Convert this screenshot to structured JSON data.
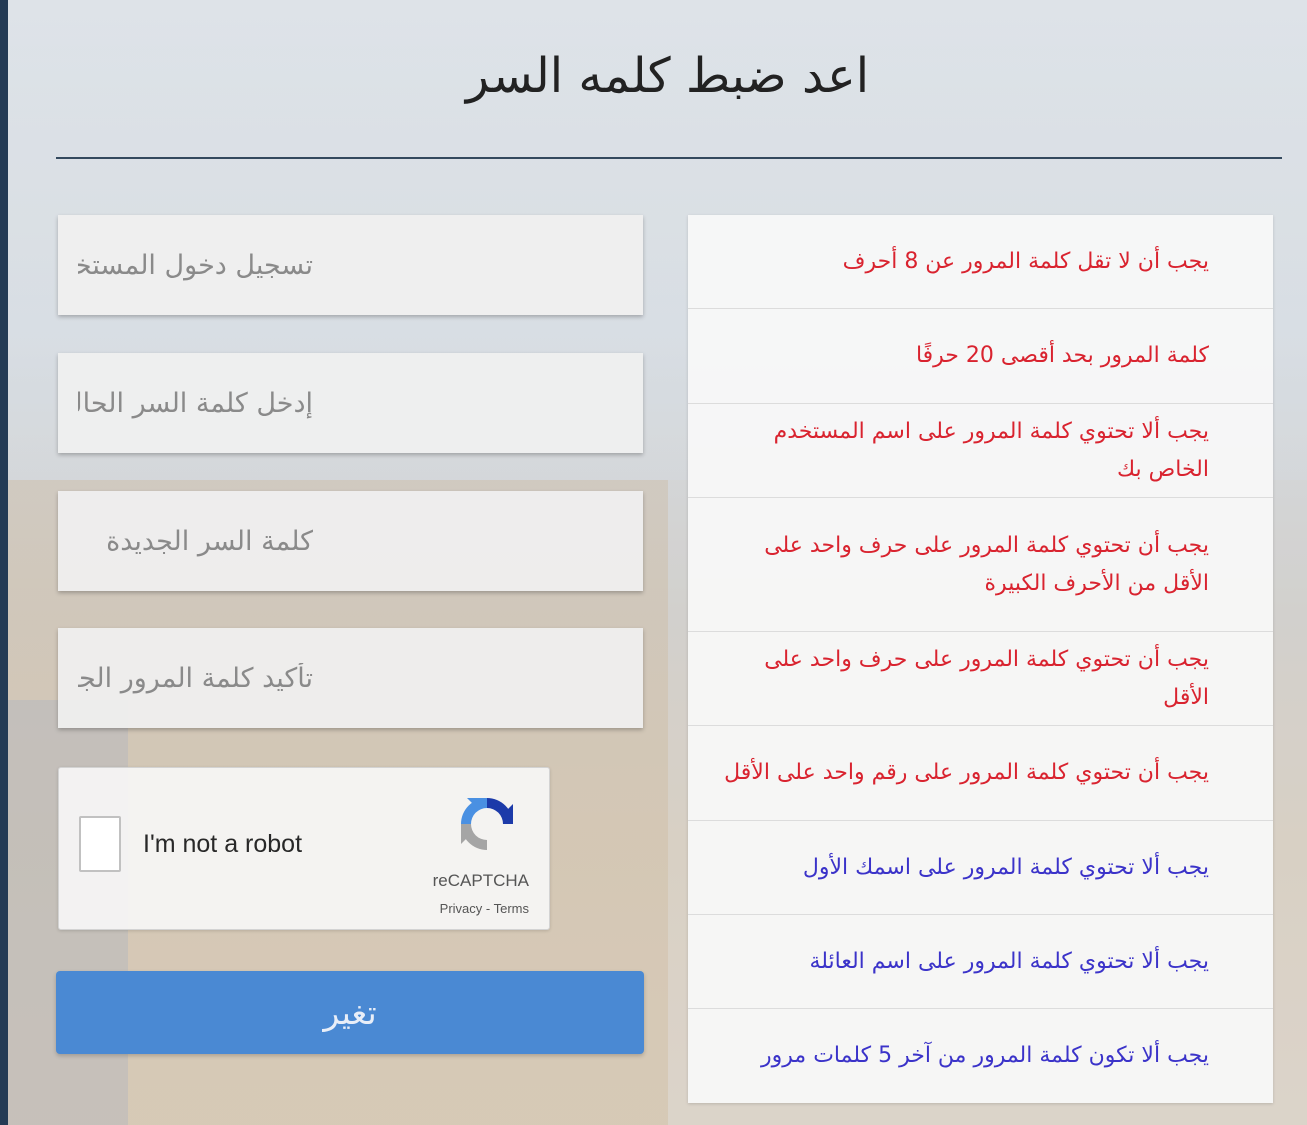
{
  "page": {
    "title": "اعد ضبط كلمه السر"
  },
  "form": {
    "username_placeholder": "تسجيل دخول المستخدم",
    "current_password_placeholder": "إدخل كلمة السر الحالية",
    "new_password_placeholder": "كلمة السر الجديدة",
    "confirm_password_placeholder": "تأكيد كلمة المرور الجديدة",
    "submit_label": "تغير"
  },
  "captcha": {
    "label": "I'm not a robot",
    "brand": "reCAPTCHA",
    "privacy": "Privacy",
    "separator": " - ",
    "terms": "Terms",
    "checked": false
  },
  "rules": {
    "items": [
      {
        "text": "يجب أن لا تقل كلمة المرور عن 8 أحرف",
        "status": "unmet",
        "color": "#d9232f"
      },
      {
        "text": "كلمة المرور بحد أقصى 20 حرفًا",
        "status": "unmet",
        "color": "#d9232f"
      },
      {
        "text": "يجب ألا تحتوي كلمة المرور على اسم المستخدم الخاص بك",
        "status": "unmet",
        "color": "#d9232f"
      },
      {
        "text": "يجب أن تحتوي كلمة المرور على حرف واحد على الأقل من الأحرف الكبيرة",
        "status": "unmet",
        "color": "#d9232f"
      },
      {
        "text": "يجب أن تحتوي كلمة المرور على حرف واحد على الأقل",
        "status": "unmet",
        "color": "#d9232f"
      },
      {
        "text": "يجب أن تحتوي كلمة المرور على رقم واحد على الأقل",
        "status": "unmet",
        "color": "#d9232f"
      },
      {
        "text": "يجب ألا تحتوي كلمة المرور على اسمك الأول",
        "status": "met",
        "color": "#3b33c9"
      },
      {
        "text": "يجب ألا تحتوي كلمة المرور على اسم العائلة",
        "status": "met",
        "color": "#3b33c9"
      },
      {
        "text": "يجب ألا تكون كلمة المرور من آخر 5 كلمات مرور",
        "status": "met",
        "color": "#3b33c9"
      }
    ]
  },
  "colors": {
    "accent_button": "#4a89d3",
    "rule_unmet": "#d9232f",
    "rule_met": "#3b33c9",
    "title_rule": "#34495e"
  }
}
